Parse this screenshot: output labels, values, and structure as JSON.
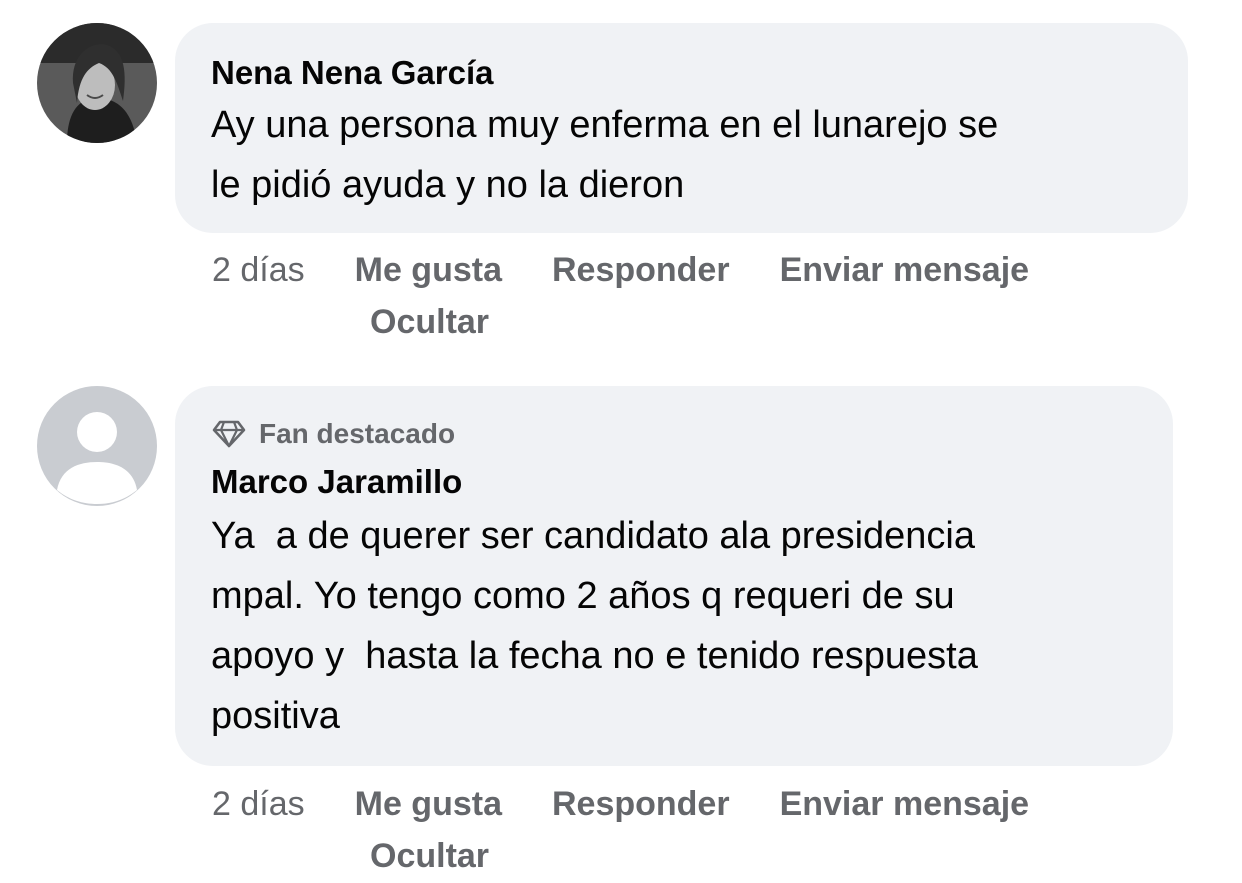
{
  "comments": [
    {
      "author": "Nena Nena García",
      "text": "Ay una persona muy enferma en el lunarejo se\nle pidió ayuda y no la dieron",
      "badge": "",
      "time": "2 días",
      "actions": {
        "like": "Me gusta",
        "reply": "Responder",
        "message": "Enviar mensaje",
        "hide": "Ocultar"
      },
      "avatar": "profile-photo"
    },
    {
      "author": "Marco Jaramillo",
      "text": "Ya  a de querer ser candidato ala presidencia\nmpal. Yo tengo como 2 años q requeri de su\napoyo y  hasta la fecha no e tenido respuesta\npositiva",
      "badge": "Fan destacado",
      "badge_icon": "diamond-icon",
      "time": "2 días",
      "actions": {
        "like": "Me gusta",
        "reply": "Responder",
        "message": "Enviar mensaje",
        "hide": "Ocultar"
      },
      "avatar": "default-avatar"
    }
  ],
  "colors": {
    "bubble": "#f0f2f5",
    "secondary_text": "#65676b",
    "primary_text": "#050505"
  }
}
